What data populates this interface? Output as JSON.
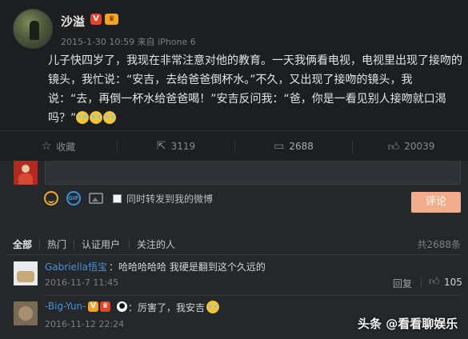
{
  "post": {
    "author": "沙溢",
    "v_badge": "V",
    "level_badge": "♛",
    "time": "2015-1-30 10:59",
    "source_prefix": "来自",
    "source": "iPhone 6",
    "text_1": "儿子快四岁了，我现在非常注意对他的教育。一天我俩看电视，电视里出现了接吻的镜头，我忙说：“安吉，去给爸爸倒杯水。”不久，又出现了接吻的镜头，我说：“去，再倒一杯水给爸爸喝！”安吉反问我：“爸，你是一看见别人接吻就口渴吗？”",
    "emoji_name": "laugh-cry-emoji"
  },
  "actions": {
    "favorite_label": "收藏",
    "repost_count": "3119",
    "comment_count": "2688",
    "like_count": "20039"
  },
  "composer": {
    "forward_label": "同时转发到我的微博",
    "submit_label": "评论",
    "gif_label": "GIF"
  },
  "filters": {
    "all": "全部",
    "hot": "热门",
    "verified": "认证用户",
    "following": "关注的人",
    "total": "共2688条"
  },
  "comments": [
    {
      "name": "Gabriella悟宝",
      "text": "：哈哈哈哈哈 我硬是翻到这个久远的",
      "time": "2016-11-7 11:45",
      "reply": "回复",
      "likes": "105"
    },
    {
      "name": "-Big-Yun-",
      "text": "：厉害了，我安吉",
      "time": "2016-11-12 22:24"
    }
  ],
  "watermark": "头条 @看看聊娱乐",
  "colors": {
    "background": "#1c1e20",
    "panel": "#25282b",
    "link": "#4a90d6",
    "submit": "#f2ae8c",
    "v_badge": "#e8412c",
    "crown": "#f3a421"
  }
}
